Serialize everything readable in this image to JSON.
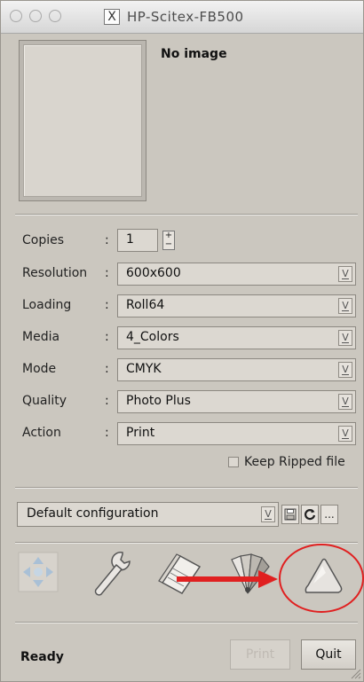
{
  "window": {
    "title": "HP-Scitex-FB500",
    "title_icon": "X"
  },
  "preview": {
    "message": "No image"
  },
  "settings": {
    "copies": {
      "label": "Copies",
      "value": "1"
    },
    "rows": [
      {
        "label": "Resolution",
        "value": "600x600"
      },
      {
        "label": "Loading",
        "value": "Roll64"
      },
      {
        "label": "Media",
        "value": "4_Colors"
      },
      {
        "label": "Mode",
        "value": "CMYK"
      },
      {
        "label": "Quality",
        "value": "Photo Plus"
      },
      {
        "label": "Action",
        "value": "Print"
      }
    ],
    "keep_ripped": {
      "label": "Keep Ripped file",
      "checked": false
    }
  },
  "config": {
    "value": "Default configuration",
    "more_label": "..."
  },
  "tools": [
    {
      "icon": "move-arrows-icon"
    },
    {
      "icon": "wrench-icon"
    },
    {
      "icon": "paper-stack-icon"
    },
    {
      "icon": "color-swatch-fan-icon"
    },
    {
      "icon": "print-triangle-icon"
    }
  ],
  "annotation": {
    "arrow_color": "#e02020",
    "circle_color": "#e02020"
  },
  "footer": {
    "status": "Ready",
    "print_label": "Print",
    "quit_label": "Quit"
  },
  "colors": {
    "window_bg": "#cbc7bf",
    "field_bg": "#dcd8d1"
  }
}
